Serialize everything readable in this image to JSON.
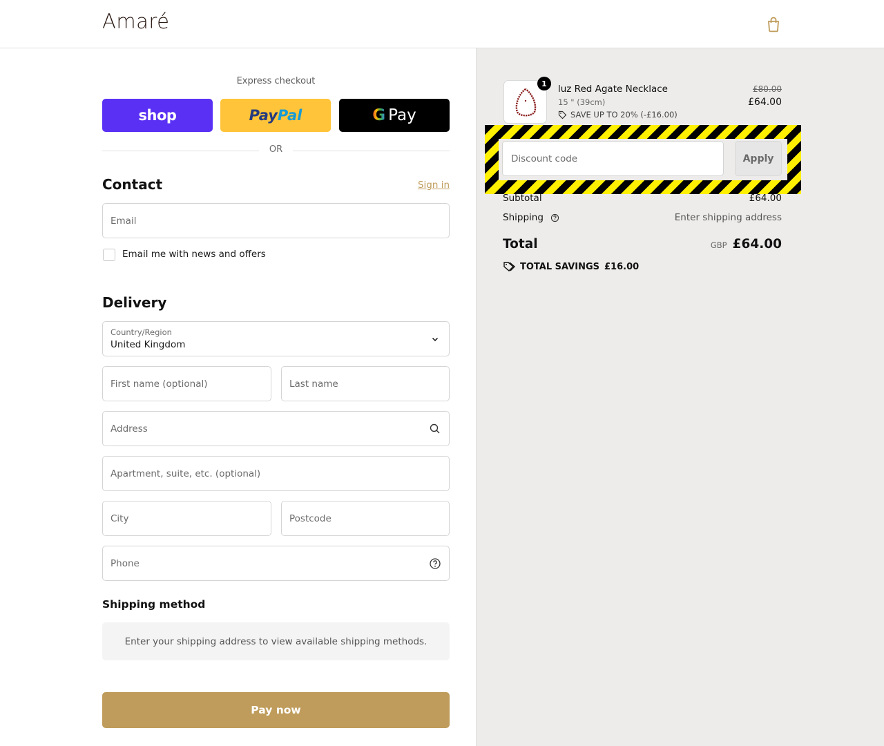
{
  "header": {
    "brand": "Amaré",
    "cart_icon": "shopping-bag-icon"
  },
  "express": {
    "label": "Express checkout",
    "shop_label": "shop",
    "paypal_part1": "Pay",
    "paypal_part2": "Pal",
    "gpay_g": "G",
    "gpay_label": "Pay",
    "or_label": "OR"
  },
  "contact": {
    "title": "Contact",
    "signin_label": "Sign in",
    "email_placeholder": "Email",
    "newsletter_label": "Email me with news and offers"
  },
  "delivery": {
    "title": "Delivery",
    "country_label": "Country/Region",
    "country_value": "United Kingdom",
    "first_name_placeholder": "First name (optional)",
    "last_name_placeholder": "Last name",
    "address_placeholder": "Address",
    "apartment_placeholder": "Apartment, suite, etc. (optional)",
    "city_placeholder": "City",
    "postcode_placeholder": "Postcode",
    "phone_placeholder": "Phone"
  },
  "shipping_method": {
    "title": "Shipping method",
    "message": "Enter your shipping address to view available shipping methods."
  },
  "pay_button": "Pay now",
  "summary": {
    "product": {
      "quantity": "1",
      "name": "luz Red Agate Necklace",
      "variant": "15 \" (39cm)",
      "savings_note": "SAVE UP TO 20% (-£16.00)",
      "original_price": "£80.00",
      "price": "£64.00"
    },
    "discount_placeholder": "Discount code",
    "apply_label": "Apply",
    "subtotal_label": "Subtotal",
    "subtotal_value": "£64.00",
    "shipping_label": "Shipping",
    "shipping_value": "Enter shipping address",
    "total_label": "Total",
    "currency": "GBP",
    "total_value": "£64.00",
    "total_savings_label": "TOTAL SAVINGS",
    "total_savings_value": "£16.00"
  },
  "colors": {
    "accent": "#bf9c5b",
    "shop_pay": "#5a31f4",
    "paypal": "#ffc439",
    "summary_bg": "#edecea"
  }
}
